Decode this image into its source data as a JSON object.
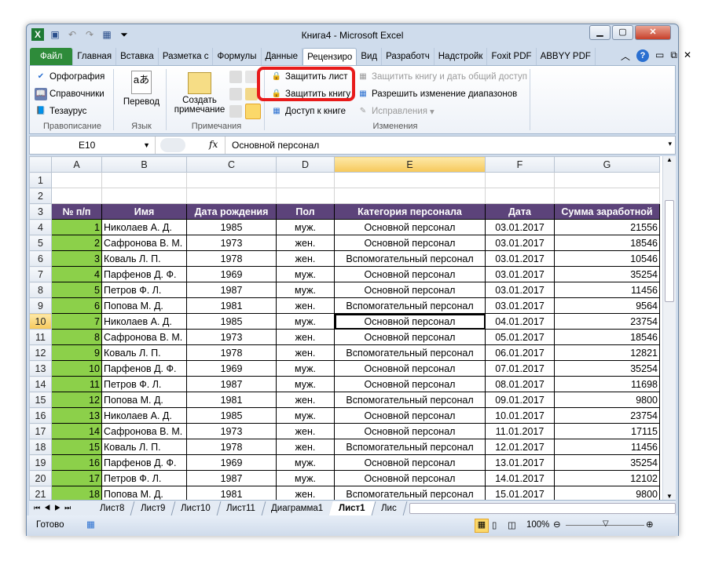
{
  "window": {
    "title": "Книга4  -  Microsoft Excel"
  },
  "tabs": [
    "Файл",
    "Главная",
    "Вставка",
    "Разметка с",
    "Формулы",
    "Данные",
    "Рецензиро",
    "Вид",
    "Разработч",
    "Надстройк",
    "Foxit PDF",
    "ABBYY PDF"
  ],
  "ribbon": {
    "spelling": "Орфография",
    "research": "Справочники",
    "thesaurus": "Тезаурус",
    "group_proofing": "Правописание",
    "translate": "Перевод",
    "group_language": "Язык",
    "new_comment_1": "Создать",
    "new_comment_2": "примечание",
    "group_comments": "Примечания",
    "protect_sheet": "Защитить лист",
    "protect_workbook": "Защитить книгу",
    "share_workbook": "Доступ к книге",
    "protect_share": "Защитить книгу и дать общий доступ",
    "allow_ranges": "Разрешить изменение диапазонов",
    "track_changes": "Исправления",
    "group_changes": "Изменения"
  },
  "formula_bar": {
    "name_box": "E10",
    "fx": "fx",
    "value": "Основной персонал"
  },
  "columns": [
    "A",
    "B",
    "C",
    "D",
    "E",
    "F",
    "G"
  ],
  "headers": [
    "№ п/п",
    "Имя",
    "Дата рождения",
    "Пол",
    "Категория персонала",
    "Дата",
    "Сумма заработной"
  ],
  "rows": [
    [
      1,
      "Николаев А. Д.",
      "1985",
      "муж.",
      "Основной персонал",
      "03.01.2017",
      "21556"
    ],
    [
      2,
      "Сафронова В. М.",
      "1973",
      "жен.",
      "Основной персонал",
      "03.01.2017",
      "18546"
    ],
    [
      3,
      "Коваль Л. П.",
      "1978",
      "жен.",
      "Вспомогательный персонал",
      "03.01.2017",
      "10546"
    ],
    [
      4,
      "Парфенов Д. Ф.",
      "1969",
      "муж.",
      "Основной персонал",
      "03.01.2017",
      "35254"
    ],
    [
      5,
      "Петров Ф. Л.",
      "1987",
      "муж.",
      "Основной персонал",
      "03.01.2017",
      "11456"
    ],
    [
      6,
      "Попова М. Д.",
      "1981",
      "жен.",
      "Вспомогательный персонал",
      "03.01.2017",
      "9564"
    ],
    [
      7,
      "Николаев А. Д.",
      "1985",
      "муж.",
      "Основной персонал",
      "04.01.2017",
      "23754"
    ],
    [
      8,
      "Сафронова В. М.",
      "1973",
      "жен.",
      "Основной персонал",
      "05.01.2017",
      "18546"
    ],
    [
      9,
      "Коваль Л. П.",
      "1978",
      "жен.",
      "Вспомогательный персонал",
      "06.01.2017",
      "12821"
    ],
    [
      10,
      "Парфенов Д. Ф.",
      "1969",
      "муж.",
      "Основной персонал",
      "07.01.2017",
      "35254"
    ],
    [
      11,
      "Петров Ф. Л.",
      "1987",
      "муж.",
      "Основной персонал",
      "08.01.2017",
      "11698"
    ],
    [
      12,
      "Попова М. Д.",
      "1981",
      "жен.",
      "Вспомогательный персонал",
      "09.01.2017",
      "9800"
    ],
    [
      13,
      "Николаев А. Д.",
      "1985",
      "муж.",
      "Основной персонал",
      "10.01.2017",
      "23754"
    ],
    [
      14,
      "Сафронова В. М.",
      "1973",
      "жен.",
      "Основной персонал",
      "11.01.2017",
      "17115"
    ],
    [
      15,
      "Коваль Л. П.",
      "1978",
      "жен.",
      "Вспомогательный персонал",
      "12.01.2017",
      "11456"
    ],
    [
      16,
      "Парфенов Д. Ф.",
      "1969",
      "муж.",
      "Основной персонал",
      "13.01.2017",
      "35254"
    ],
    [
      17,
      "Петров Ф. Л.",
      "1987",
      "муж.",
      "Основной персонал",
      "14.01.2017",
      "12102"
    ],
    [
      18,
      "Попова М. Д.",
      "1981",
      "жен.",
      "Вспомогательный персонал",
      "15.01.2017",
      "9800"
    ]
  ],
  "sheets": [
    "Лист8",
    "Лист9",
    "Лист10",
    "Лист11",
    "Диаграмма1",
    "Лист1",
    "Лис"
  ],
  "status": {
    "ready": "Готово",
    "zoom": "100%"
  }
}
